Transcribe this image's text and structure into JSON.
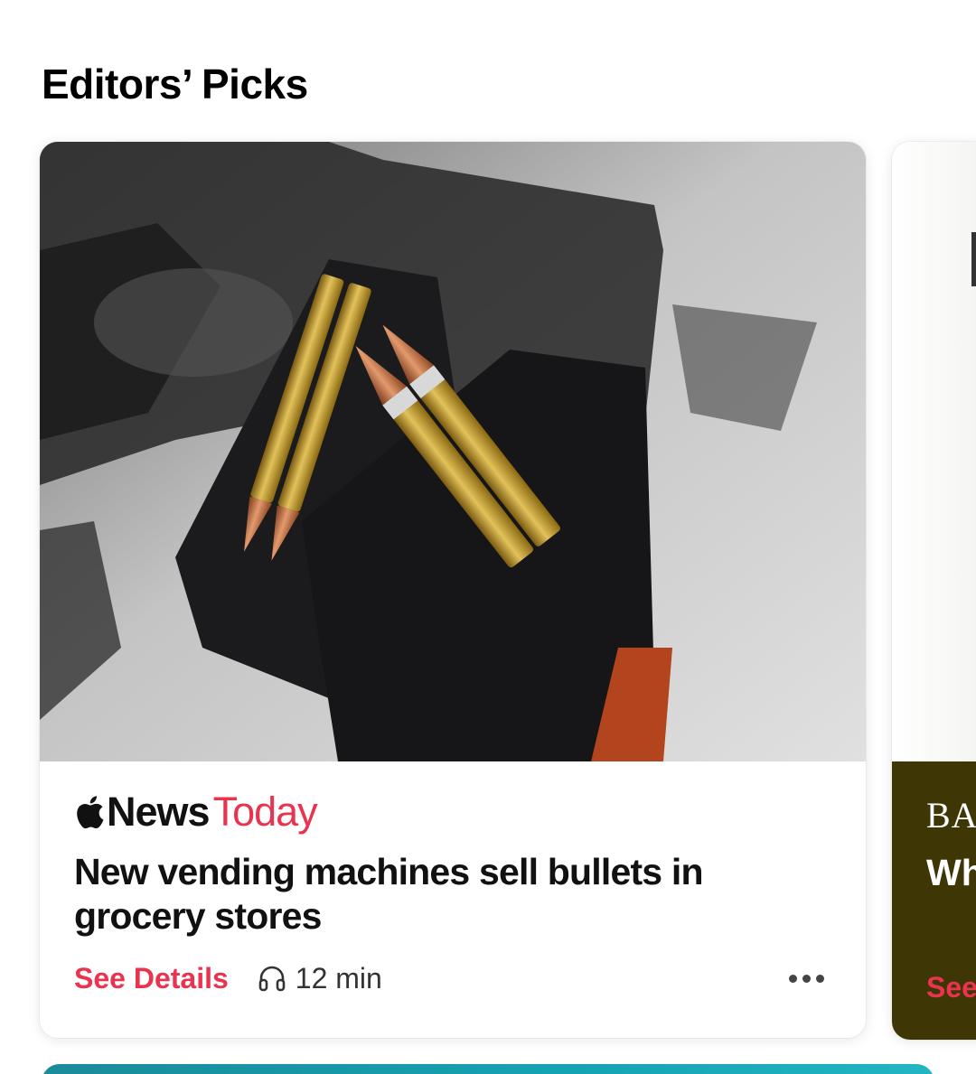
{
  "section": {
    "title": "Editors’ Picks"
  },
  "feature_card": {
    "image_description_icon": "photo",
    "brand_news": "News",
    "brand_today": "Today",
    "headline": "New vending machines sell bullets in grocery stores",
    "see_details_label": "See Details",
    "listen_icon": "headphones-icon",
    "duration": "12 min",
    "more_icon": "ellipsis-icon"
  },
  "second_card": {
    "brand_partial": "BAZ",
    "headline_partial": "Wh",
    "see_partial": "See"
  },
  "colors": {
    "accent": "#e9334f",
    "second_card_footer": "#3f3606",
    "next_card_teal": "#15a3b3"
  }
}
